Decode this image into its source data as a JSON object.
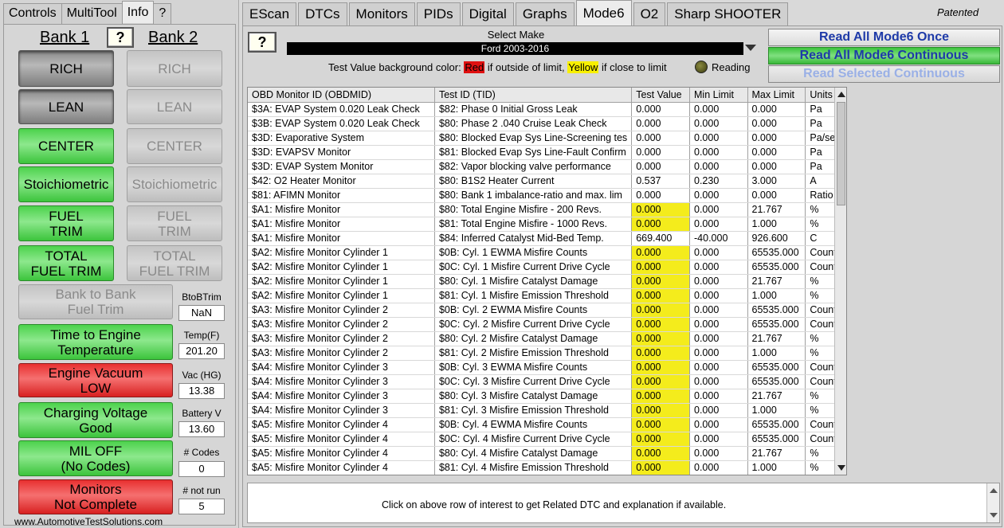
{
  "left_tabs": [
    "Controls",
    "MultiTool",
    "Info",
    "?"
  ],
  "bank1": "Bank 1",
  "bank2": "Bank 2",
  "help": "?",
  "bank1_buttons": [
    "RICH",
    "LEAN",
    "CENTER",
    "Stoichiometric",
    "FUEL\nTRIM",
    "TOTAL\nFUEL TRIM"
  ],
  "bank2_buttons": [
    "RICH",
    "LEAN",
    "CENTER",
    "Stoichiometric",
    "FUEL\nTRIM",
    "TOTAL\nFUEL TRIM"
  ],
  "status": [
    {
      "label": "Bank to Bank\nFuel Trim",
      "side_label": "BtoBTrim",
      "value": "NaN"
    },
    {
      "label": "Time to Engine\nTemperature",
      "side_label": "Temp(F)",
      "value": "201.20"
    },
    {
      "label": "Engine Vacuum\nLOW",
      "side_label": "Vac (HG)",
      "value": "13.38"
    },
    {
      "label": "Charging Voltage\nGood",
      "side_label": "Battery V",
      "value": "13.60"
    },
    {
      "label": "MIL OFF\n(No Codes)",
      "side_label": "# Codes",
      "value": "0"
    },
    {
      "label": "Monitors\nNot Complete",
      "side_label": "# not run",
      "value": "5"
    }
  ],
  "website": "www.AutomotiveTestSolutions.com",
  "right_tabs": [
    "EScan",
    "DTCs",
    "Monitors",
    "PIDs",
    "Digital",
    "Graphs",
    "Mode6",
    "O2",
    "Sharp SHOOTER"
  ],
  "patented": "Patented",
  "select_make_label": "Select Make",
  "select_make_value": "Ford 2003-2016",
  "legend": {
    "prefix": "Test Value background color:",
    "red": "Red",
    "mid": "if outside of limit,",
    "yellow": "Yellow",
    "suffix": "if close to limit"
  },
  "reading": "Reading",
  "actions": [
    "Read All Mode6 Once",
    "Read All Mode6 Continuous",
    "Read Selected Continuous"
  ],
  "table": {
    "headers": [
      "OBD Monitor ID (OBDMID)",
      "Test ID (TID)",
      "Test Value",
      "Min Limit",
      "Max Limit",
      "Units"
    ],
    "rows": [
      {
        "mid": "$3A: EVAP System 0.020 Leak Check",
        "tid": "$82: Phase 0 Initial Gross Leak",
        "val": "0.000",
        "min": "0.000",
        "max": "0.000",
        "units": "Pa",
        "hl": false
      },
      {
        "mid": "$3B: EVAP System 0.020 Leak Check",
        "tid": "$80: Phase 2 .040 Cruise Leak Check",
        "val": "0.000",
        "min": "0.000",
        "max": "0.000",
        "units": "Pa",
        "hl": false
      },
      {
        "mid": "$3D: Evaporative System",
        "tid": "$80: Blocked Evap Sys Line-Screening tes",
        "val": "0.000",
        "min": "0.000",
        "max": "0.000",
        "units": "Pa/sec",
        "hl": false
      },
      {
        "mid": "$3D: EVAPSV Monitor",
        "tid": "$81: Blocked Evap Sys Line-Fault Confirm",
        "val": "0.000",
        "min": "0.000",
        "max": "0.000",
        "units": "Pa",
        "hl": false
      },
      {
        "mid": "$3D: EVAP System Monitor",
        "tid": "$82: Vapor blocking valve performance",
        "val": "0.000",
        "min": "0.000",
        "max": "0.000",
        "units": "Pa",
        "hl": false
      },
      {
        "mid": "$42: O2 Heater Monitor",
        "tid": "$80: B1S2 Heater Current",
        "val": "0.537",
        "min": "0.230",
        "max": "3.000",
        "units": "A",
        "hl": false
      },
      {
        "mid": "$81: AFIMN Monitor",
        "tid": "$80: Bank 1 imbalance-ratio and max. lim",
        "val": "0.000",
        "min": "0.000",
        "max": "0.000",
        "units": "Ratio",
        "hl": false
      },
      {
        "mid": "$A1: Misfire Monitor",
        "tid": "$80: Total Engine Misfire - 200 Revs.",
        "val": "0.000",
        "min": "0.000",
        "max": "21.767",
        "units": "%",
        "hl": true
      },
      {
        "mid": "$A1: Misfire Monitor",
        "tid": "$81: Total Engine Misfire - 1000 Revs.",
        "val": "0.000",
        "min": "0.000",
        "max": "1.000",
        "units": "%",
        "hl": true
      },
      {
        "mid": "$A1: Misfire Monitor",
        "tid": "$84: Inferred Catalyst Mid-Bed Temp.",
        "val": "669.400",
        "min": "-40.000",
        "max": "926.600",
        "units": "C",
        "hl": false
      },
      {
        "mid": "$A2: Misfire Monitor Cylinder 1",
        "tid": "$0B: Cyl. 1 EWMA Misfire Counts",
        "val": "0.000",
        "min": "0.000",
        "max": "65535.000",
        "units": "Counts",
        "hl": true
      },
      {
        "mid": "$A2: Misfire Monitor Cylinder 1",
        "tid": "$0C: Cyl. 1 Misfire Current Drive Cycle",
        "val": "0.000",
        "min": "0.000",
        "max": "65535.000",
        "units": "Counts",
        "hl": true
      },
      {
        "mid": "$A2: Misfire Monitor Cylinder 1",
        "tid": "$80: Cyl. 1 Misfire Catalyst Damage",
        "val": "0.000",
        "min": "0.000",
        "max": "21.767",
        "units": "%",
        "hl": true
      },
      {
        "mid": "$A2: Misfire Monitor Cylinder 1",
        "tid": "$81: Cyl. 1 Misfire Emission Threshold",
        "val": "0.000",
        "min": "0.000",
        "max": "1.000",
        "units": "%",
        "hl": true
      },
      {
        "mid": "$A3: Misfire Monitor Cylinder 2",
        "tid": "$0B: Cyl. 2 EWMA Misfire Counts",
        "val": "0.000",
        "min": "0.000",
        "max": "65535.000",
        "units": "Counts",
        "hl": true
      },
      {
        "mid": "$A3: Misfire Monitor Cylinder 2",
        "tid": "$0C: Cyl. 2 Misfire Current Drive Cycle",
        "val": "0.000",
        "min": "0.000",
        "max": "65535.000",
        "units": "Counts",
        "hl": true
      },
      {
        "mid": "$A3: Misfire Monitor Cylinder 2",
        "tid": "$80: Cyl. 2 Misfire Catalyst Damage",
        "val": "0.000",
        "min": "0.000",
        "max": "21.767",
        "units": "%",
        "hl": true
      },
      {
        "mid": "$A3: Misfire Monitor Cylinder 2",
        "tid": "$81: Cyl. 2 Misfire Emission Threshold",
        "val": "0.000",
        "min": "0.000",
        "max": "1.000",
        "units": "%",
        "hl": true
      },
      {
        "mid": "$A4: Misfire Monitor Cylinder 3",
        "tid": "$0B: Cyl. 3 EWMA Misfire Counts",
        "val": "0.000",
        "min": "0.000",
        "max": "65535.000",
        "units": "Counts",
        "hl": true
      },
      {
        "mid": "$A4: Misfire Monitor Cylinder 3",
        "tid": "$0C: Cyl. 3 Misfire Current Drive Cycle",
        "val": "0.000",
        "min": "0.000",
        "max": "65535.000",
        "units": "Counts",
        "hl": true
      },
      {
        "mid": "$A4: Misfire Monitor Cylinder 3",
        "tid": "$80: Cyl. 3 Misfire Catalyst Damage",
        "val": "0.000",
        "min": "0.000",
        "max": "21.767",
        "units": "%",
        "hl": true
      },
      {
        "mid": "$A4: Misfire Monitor Cylinder 3",
        "tid": "$81: Cyl. 3 Misfire Emission Threshold",
        "val": "0.000",
        "min": "0.000",
        "max": "1.000",
        "units": "%",
        "hl": true
      },
      {
        "mid": "$A5: Misfire Monitor Cylinder 4",
        "tid": "$0B: Cyl. 4 EWMA Misfire Counts",
        "val": "0.000",
        "min": "0.000",
        "max": "65535.000",
        "units": "Counts",
        "hl": true
      },
      {
        "mid": "$A5: Misfire Monitor Cylinder 4",
        "tid": "$0C: Cyl. 4 Misfire Current Drive Cycle",
        "val": "0.000",
        "min": "0.000",
        "max": "65535.000",
        "units": "Counts",
        "hl": true
      },
      {
        "mid": "$A5: Misfire Monitor Cylinder 4",
        "tid": "$80: Cyl. 4 Misfire Catalyst Damage",
        "val": "0.000",
        "min": "0.000",
        "max": "21.767",
        "units": "%",
        "hl": true
      },
      {
        "mid": "$A5: Misfire Monitor Cylinder 4",
        "tid": "$81: Cyl. 4 Misfire Emission Threshold",
        "val": "0.000",
        "min": "0.000",
        "max": "1.000",
        "units": "%",
        "hl": true
      }
    ]
  },
  "info_text": "Click on above row of interest to get Related DTC and explanation if available.",
  "colors": {
    "highlight_yellow": "#f4ec1c",
    "green": "#4cd24c",
    "red": "#e83030",
    "action_text": "#1e3aa8"
  }
}
